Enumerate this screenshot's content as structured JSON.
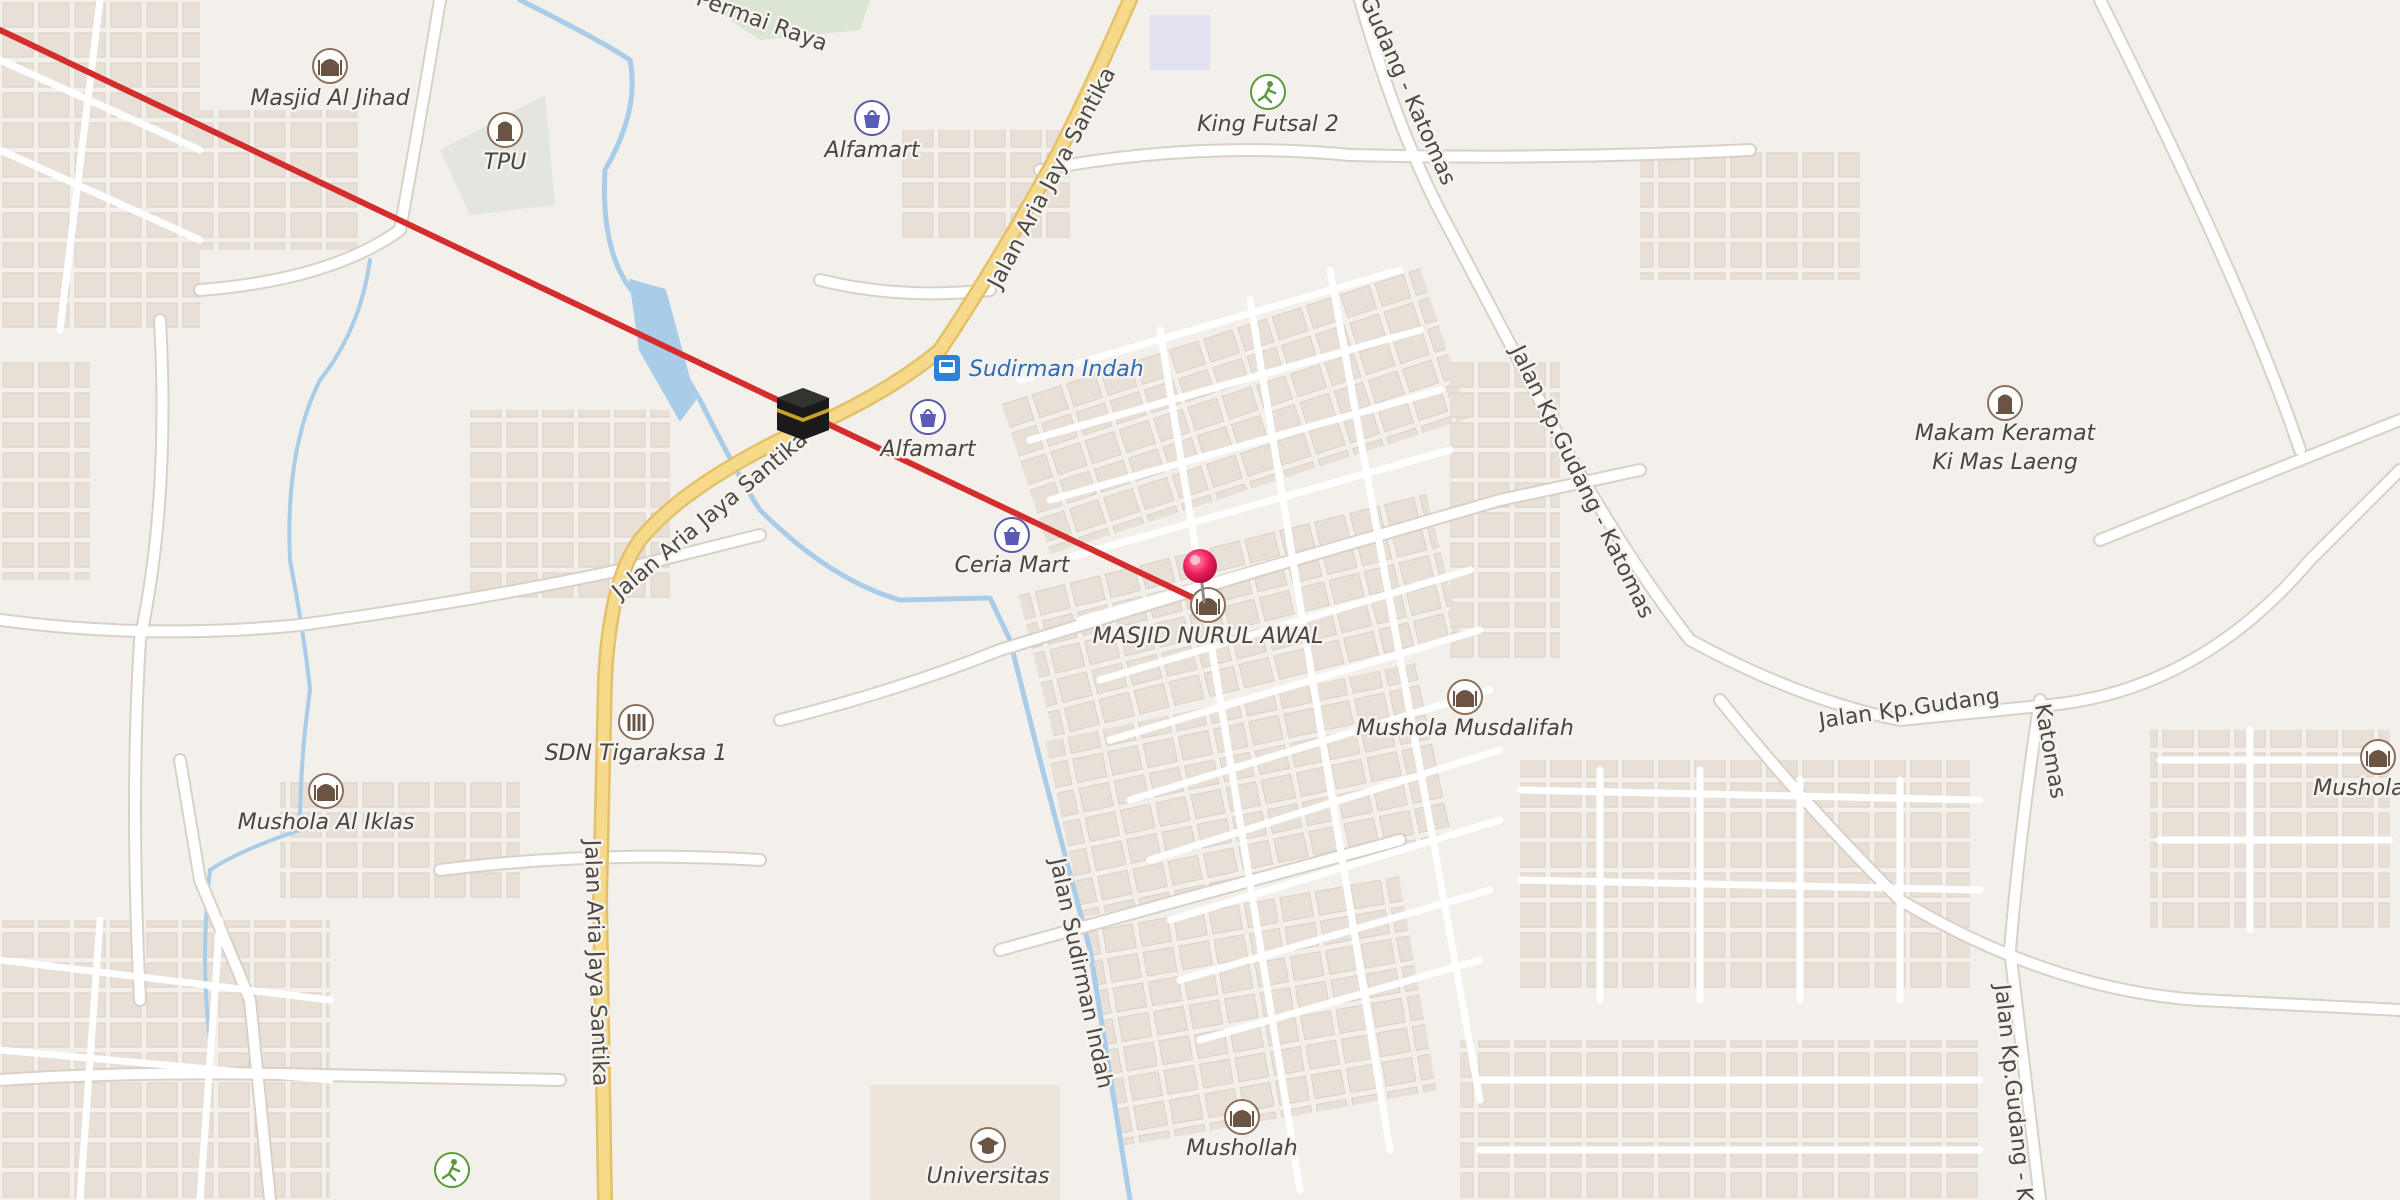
{
  "colors": {
    "background": "#f3efea",
    "road_minor": "#ffffff",
    "road_minor_casing": "#dcd6cf",
    "road_primary": "#f7d98a",
    "road_primary_casing": "#e3c06a",
    "water": "#a9cde8",
    "building": "#e6ded4",
    "park": "#dbe5d3",
    "qibla_line": "#d42d2d",
    "marker": "#ec1d59"
  },
  "road_labels": [
    "Permai Raya",
    "Jalan Aria Jaya Santika",
    "Jalan Aria Jaya Santika",
    "Jalan Aria Jaya Santika",
    "Gudang - Katomas",
    "Jalan Kp.Gudang - Katomas",
    "Jalan Kp.Gudang",
    "Katomas",
    "Jalan Sudirman Indah",
    "Jalan Kp.Gudang - K"
  ],
  "pois": [
    {
      "name": "Masjid Al Jihad",
      "icon": "mosque-icon"
    },
    {
      "name": "TPU",
      "icon": "cemetery-icon"
    },
    {
      "name": "Alfamart",
      "icon": "shop-bag-icon"
    },
    {
      "name": "King Futsal 2",
      "icon": "sports-icon"
    },
    {
      "name": "Sudirman Indah",
      "icon": "bus-stop-icon"
    },
    {
      "name": "Alfamart",
      "icon": "shop-bag-icon"
    },
    {
      "name": "Ceria Mart",
      "icon": "shop-bag-icon"
    },
    {
      "name": "MASJID NURUL AWAL",
      "icon": "mosque-icon"
    },
    {
      "name": "Makam Keramat\nKi Mas Laeng",
      "icon": "cemetery-icon"
    },
    {
      "name": "Mushola Musdalifah",
      "icon": "mosque-icon"
    },
    {
      "name": "SDN Tigaraksa 1",
      "icon": "school-icon"
    },
    {
      "name": "Mushola Al Iklas",
      "icon": "mosque-icon"
    },
    {
      "name": "Mushola Al",
      "icon": "mosque-icon"
    },
    {
      "name": "Mushollah",
      "icon": "mosque-icon"
    },
    {
      "name": "Universitas",
      "icon": "university-icon"
    },
    {
      "name": "",
      "icon": "sports-icon"
    }
  ],
  "qibla": {
    "icon": "kaaba-icon"
  },
  "marker": {
    "icon": "location-pin-icon"
  }
}
